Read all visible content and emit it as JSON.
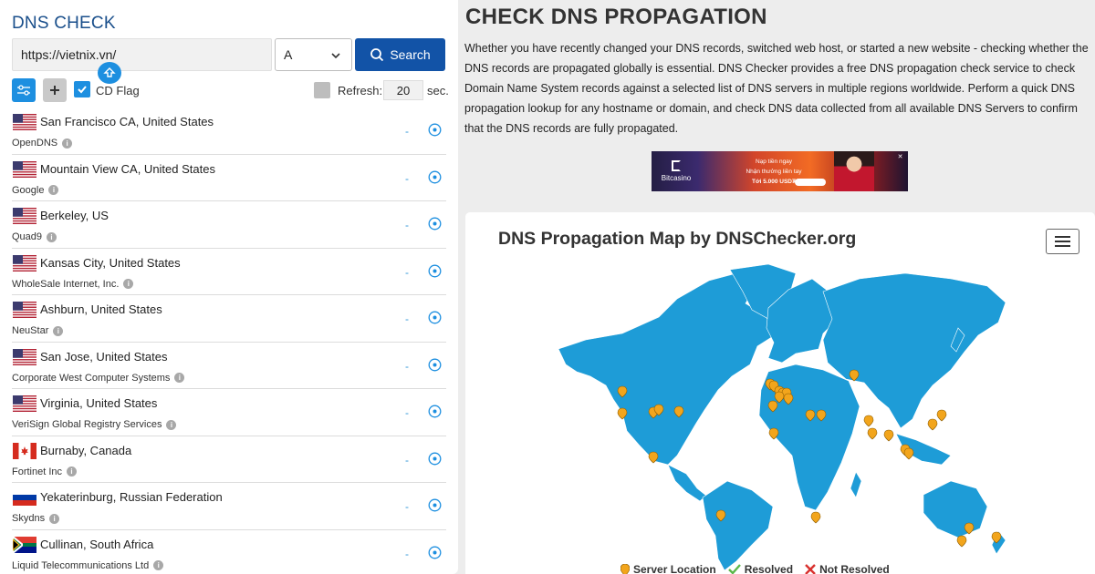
{
  "brand": "DNS CHECK",
  "search": {
    "url_value": "https://vietnix.vn/",
    "record_type": "A",
    "button_label": "Search"
  },
  "controls": {
    "cd_flag_label": "CD Flag",
    "cd_flag_checked": true,
    "refresh_label": "Refresh:",
    "refresh_value": "20",
    "refresh_unit": "sec."
  },
  "servers": [
    {
      "location": "San Francisco CA, United States",
      "provider": "OpenDNS",
      "flag": "us",
      "result": "-"
    },
    {
      "location": "Mountain View CA, United States",
      "provider": "Google",
      "flag": "us",
      "result": "-"
    },
    {
      "location": "Berkeley, US",
      "provider": "Quad9",
      "flag": "us",
      "result": "-"
    },
    {
      "location": "Kansas City, United States",
      "provider": "WholeSale Internet, Inc.",
      "flag": "us",
      "result": "-"
    },
    {
      "location": "Ashburn, United States",
      "provider": "NeuStar",
      "flag": "us",
      "result": "-"
    },
    {
      "location": "San Jose, United States",
      "provider": "Corporate West Computer Systems",
      "flag": "us",
      "result": "-"
    },
    {
      "location": "Virginia, United States",
      "provider": "VeriSign Global Registry Services",
      "flag": "us",
      "result": "-"
    },
    {
      "location": "Burnaby, Canada",
      "provider": "Fortinet Inc",
      "flag": "ca",
      "result": "-"
    },
    {
      "location": "Yekaterinburg, Russian Federation",
      "provider": "Skydns",
      "flag": "ru",
      "result": "-"
    },
    {
      "location": "Cullinan, South Africa",
      "provider": "Liquid Telecommunications Ltd",
      "flag": "za",
      "result": "-"
    }
  ],
  "main": {
    "title": "CHECK DNS PROPAGATION",
    "intro": "Whether you have recently changed your DNS records, switched web host, or started a new website - checking whether the DNS records are propagated globally is essential. DNS Checker provides a free DNS propagation check service to check Domain Name System records against a selected list of DNS servers in multiple regions worldwide. Perform a quick DNS propagation lookup for any hostname or domain, and check DNS data collected from all available DNS Servers to confirm that the DNS records are fully propagated."
  },
  "ad": {
    "brand": "Bitcasino",
    "line1": "Nạp tiền ngay",
    "line2": "Nhận thưởng liền tay",
    "line3": "Tới 5.000 USD₮"
  },
  "map": {
    "title": "DNS Propagation Map by DNSChecker.org",
    "land_color": "#1e9cd7",
    "marker_color": "#f2a51c",
    "legend": {
      "server_location": "Server Location",
      "resolved": "Resolved",
      "not_resolved": "Not Resolved"
    }
  },
  "colors": {
    "brand": "#1a4f8b",
    "primary_button": "#1253a7",
    "accent": "#1d8fe0"
  }
}
